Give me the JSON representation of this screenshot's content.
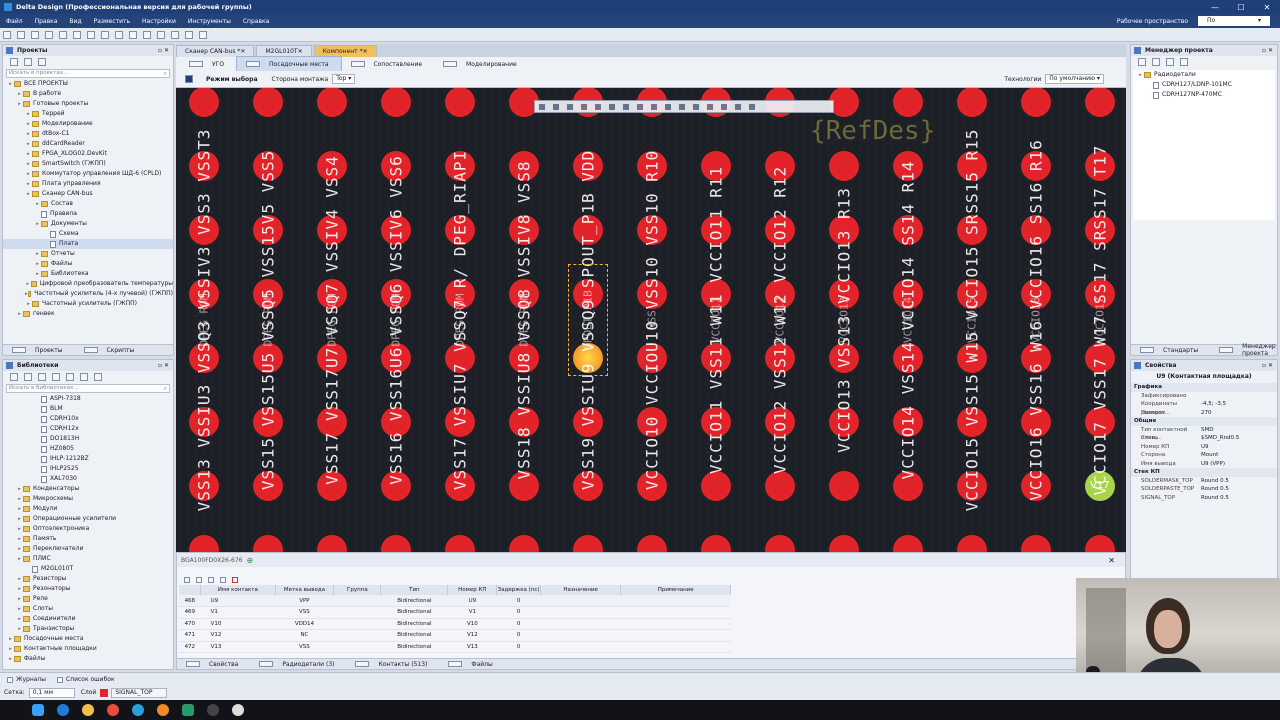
{
  "app": {
    "title": "Delta Design (Профессиональная версия для рабочей группы)",
    "window_min": "—",
    "window_max": "☐",
    "window_close": "✕"
  },
  "menu": {
    "items": [
      "Файл",
      "Правка",
      "Вид",
      "Разместить",
      "Настройки",
      "Инструменты",
      "Справка"
    ],
    "workspace_label": "Рабочее пространство",
    "workspace_value": "По умолчанию"
  },
  "projects_panel": {
    "title": "Проекты",
    "search_placeholder": "Искать в проектах...",
    "tree": [
      {
        "label": "ВСЕ ПРОЕКТЫ",
        "level": 0,
        "type": "folder"
      },
      {
        "label": "В работе",
        "level": 1,
        "type": "folder"
      },
      {
        "label": "Готовые проекты",
        "level": 1,
        "type": "folder"
      },
      {
        "label": "Террей",
        "level": 2,
        "type": "folder"
      },
      {
        "label": "Моделирование",
        "level": 2,
        "type": "folder"
      },
      {
        "label": "dtBox-C1",
        "level": 2,
        "type": "folder"
      },
      {
        "label": "ddCardReader",
        "level": 2,
        "type": "folder"
      },
      {
        "label": "FPGA_XLOG02.DevKit",
        "level": 2,
        "type": "folder"
      },
      {
        "label": "SmartSwitch (ГЖПП)",
        "level": 2,
        "type": "folder"
      },
      {
        "label": "Коммутатор управления ШД-6 (CPLD)",
        "level": 2,
        "type": "folder"
      },
      {
        "label": "Плата управления",
        "level": 2,
        "type": "folder"
      },
      {
        "label": "Сканер CAN-bus",
        "level": 2,
        "type": "folder"
      },
      {
        "label": "Состав",
        "level": 3,
        "type": "folder"
      },
      {
        "label": "Правила",
        "level": 3,
        "type": "doc"
      },
      {
        "label": "Документы",
        "level": 3,
        "type": "folder"
      },
      {
        "label": "Схема",
        "level": 4,
        "type": "doc"
      },
      {
        "label": "Плата",
        "level": 4,
        "type": "doc",
        "selected": true
      },
      {
        "label": "Отчеты",
        "level": 3,
        "type": "folder"
      },
      {
        "label": "Файлы",
        "level": 3,
        "type": "folder"
      },
      {
        "label": "Библиотека",
        "level": 3,
        "type": "folder"
      },
      {
        "label": "Цифровой преобразователь температуры",
        "level": 2,
        "type": "folder"
      },
      {
        "label": "Частотный усилитель (4-х лучевой) (ГЖПП)",
        "level": 2,
        "type": "folder"
      },
      {
        "label": "Частотный усилитель (ГЖПП)",
        "level": 2,
        "type": "folder"
      },
      {
        "label": "генвек",
        "level": 1,
        "type": "folder"
      }
    ],
    "tabs": [
      "Проекты",
      "Скрипты"
    ]
  },
  "libraries_panel": {
    "title": "Библиотеки",
    "search_placeholder": "Искать в библиотеках...",
    "tree": [
      {
        "label": "ASPI-7318",
        "level": 3,
        "type": "doc"
      },
      {
        "label": "BLM",
        "level": 3,
        "type": "doc"
      },
      {
        "label": "CDRH10x",
        "level": 3,
        "type": "doc"
      },
      {
        "label": "CDRH12x",
        "level": 3,
        "type": "doc"
      },
      {
        "label": "DO1813H",
        "level": 3,
        "type": "doc"
      },
      {
        "label": "HZ0805",
        "level": 3,
        "type": "doc"
      },
      {
        "label": "IHLP-1212BZ",
        "level": 3,
        "type": "doc"
      },
      {
        "label": "IHLP2525",
        "level": 3,
        "type": "doc"
      },
      {
        "label": "XAL7030",
        "level": 3,
        "type": "doc"
      },
      {
        "label": "Конденсаторы",
        "level": 1,
        "type": "folder"
      },
      {
        "label": "Микросхемы",
        "level": 1,
        "type": "folder"
      },
      {
        "label": "Модули",
        "level": 1,
        "type": "folder"
      },
      {
        "label": "Операционные усилители",
        "level": 1,
        "type": "folder"
      },
      {
        "label": "Оптоэлектроника",
        "level": 1,
        "type": "folder"
      },
      {
        "label": "Память",
        "level": 1,
        "type": "folder"
      },
      {
        "label": "Переключатели",
        "level": 1,
        "type": "folder"
      },
      {
        "label": "ПЛИС",
        "level": 1,
        "type": "folder"
      },
      {
        "label": "M2GL010T",
        "level": 2,
        "type": "doc"
      },
      {
        "label": "Резисторы",
        "level": 1,
        "type": "folder"
      },
      {
        "label": "Резонаторы",
        "level": 1,
        "type": "folder"
      },
      {
        "label": "Реле",
        "level": 1,
        "type": "folder"
      },
      {
        "label": "Слоты",
        "level": 1,
        "type": "folder"
      },
      {
        "label": "Соединители",
        "level": 1,
        "type": "folder"
      },
      {
        "label": "Транзисторы",
        "level": 1,
        "type": "folder"
      },
      {
        "label": "Посадочные места",
        "level": 0,
        "type": "folder"
      },
      {
        "label": "Контактные площадки",
        "level": 0,
        "type": "folder"
      },
      {
        "label": "Файлы",
        "level": 0,
        "type": "folder"
      }
    ]
  },
  "doc_tabs": [
    {
      "label": "Сканер CAN-bus *",
      "active": false
    },
    {
      "label": "M2GL010T",
      "active": false
    },
    {
      "label": "Компонент *",
      "active": true
    }
  ],
  "sub_tabs": [
    {
      "label": "УГО",
      "active": false
    },
    {
      "label": "Посадочные места",
      "active": true
    },
    {
      "label": "Сопоставление",
      "active": false
    },
    {
      "label": "Моделирование",
      "active": false
    }
  ],
  "mode_bar": {
    "mode_label": "Режим выбора",
    "side_label": "Сторона монтажа",
    "side_value": "Top",
    "tech_label": "Технологии",
    "tech_value": "По умолчанию"
  },
  "canvas": {
    "refdes": "{RefDes}",
    "columns": [
      {
        "text": "VSS13 VSSIU3 VSSQ3 VSSIV3 VSS3 VSST3",
        "ghost": "DPEG ROM"
      },
      {
        "text": "VSS15 VSS15U5 VSSQ5 VSS15V5 VSS5",
        "ghost": "DPEG ROM"
      },
      {
        "text": "VSS17 VSS17U7 VSSQ7 VSSIV4 VSS4",
        "ghost": "DPEG ROM"
      },
      {
        "text": "VSS16 VSS16U6 VSSQ6 VSSIV6 VSS6",
        "ghost": "DPEG ROM"
      },
      {
        "text": "VSS17 VSSIU7 VSSQ7 R/ DPEG_RIAPI",
        "ghost": "DPEG ROM"
      },
      {
        "text": "VSS18 VSSIU8 VSSQ8 VSSIV8 VSS8",
        "ghost": "DPEG ROM"
      },
      {
        "text": "VSS19 VSSIU9 VSSQ9 SPOUT_P1B VDD",
        "ghost": "SPOUT_P1B"
      },
      {
        "text": "VCCIO10 VCCIOU10 VSS10 VSS10 R10",
        "ghost": "NSS"
      },
      {
        "text": "VCCIO11 VSS11 W11 VCCIO11 R11",
        "ghost": "VCCIO11"
      },
      {
        "text": "VCCIO12 VSS12 W12 VCCIO12 R12",
        "ghost": "VCCIO12"
      },
      {
        "text": "VCCIO13 VSS13 VCCIO13 R13",
        "ghost": "VCCIO13"
      },
      {
        "text": "VCCIO14 VSS14 VCCIO14 SS14 R14",
        "ghost": "VCCIO14"
      },
      {
        "text": "VCCIO15 VSS15 W15 VCCIO15 SRSS15 R15",
        "ghost": "VCCIO15"
      },
      {
        "text": "VCCIO16 VSS16 W16 VCCIO16 SS16 R16",
        "ghost": "VCCIO16"
      },
      {
        "text": "VCCIO17 VSS17 W17 SS17 SRSS17 T17",
        "ghost": "VCCIO17"
      }
    ],
    "green_pad_label": "V17"
  },
  "bottom_pane": {
    "tab_label": "BGA100FD0X26-676",
    "columns": [
      "Имя контакта",
      "Метка вывода",
      "Группа",
      "Тип",
      "Номер КП",
      "Задержка (пс)",
      "Назначение",
      "Примечание"
    ],
    "rows": [
      {
        "n": "468",
        "name": "U9",
        "label": "VPP",
        "group": "",
        "type": "Bidirectional",
        "pad": "U9",
        "delay": "0"
      },
      {
        "n": "469",
        "name": "V1",
        "label": "VSS",
        "group": "",
        "type": "Bidirectional",
        "pad": "V1",
        "delay": "0"
      },
      {
        "n": "470",
        "name": "V10",
        "label": "VDD14",
        "group": "",
        "type": "Bidirectional",
        "pad": "V10",
        "delay": "0"
      },
      {
        "n": "471",
        "name": "V12",
        "label": "NC",
        "group": "",
        "type": "Bidirectional",
        "pad": "V12",
        "delay": "0"
      },
      {
        "n": "472",
        "name": "V13",
        "label": "VSS",
        "group": "",
        "type": "Bidirectional",
        "pad": "V13",
        "delay": "0"
      }
    ],
    "tabs": [
      "Свойства",
      "Радиодетали (3)",
      "Контакты (513)",
      "Файлы"
    ]
  },
  "project_manager": {
    "title": "Менеджер проекта",
    "tree": [
      {
        "label": "Радиодетали",
        "level": 0
      },
      {
        "label": "CDRH127/LDNP-101MC",
        "level": 1
      },
      {
        "label": "CDRH127NP-470MC",
        "level": 1
      }
    ],
    "tabs": [
      "Стандарты",
      "Менеджер проекта"
    ]
  },
  "properties": {
    "title": "Свойства",
    "object": "U9 (Контактная площадка)",
    "rows": [
      {
        "section": "Графика"
      },
      {
        "k": "Зафиксировано",
        "v": ""
      },
      {
        "k": "Координаты располо...",
        "v": "-4,5; -3,5"
      },
      {
        "k": "Поворот",
        "v": "270"
      },
      {
        "section": "Общие"
      },
      {
        "k": "Тип контактной площ...",
        "v": "SMD"
      },
      {
        "k": "Стиль",
        "v": "$SMD_Rnd0.5"
      },
      {
        "k": "Номер КП",
        "v": "U9"
      },
      {
        "k": "Сторона",
        "v": "Mount"
      },
      {
        "k": "Имя вывода",
        "v": "U9 (VPP)"
      },
      {
        "section": "Стек КП"
      },
      {
        "k": "SOLDERMASK_TOP",
        "v": "Round 0.5"
      },
      {
        "k": "SOLDERPASTE_TOP",
        "v": "Round 0.5"
      },
      {
        "k": "SIGNAL_TOP",
        "v": "Round 0.5"
      }
    ]
  },
  "status": {
    "tabs": [
      "Журналы",
      "Список ошибок"
    ],
    "grid_label": "Сетка:",
    "grid_value": "0,1 мм",
    "layer_label": "Слой",
    "layer_value": "SIGNAL_TOP",
    "layer_color": "#e2232a"
  },
  "taskbar": {
    "icons": [
      "windows-icon",
      "edge-icon",
      "explorer-icon",
      "chrome-icon",
      "telegram-icon",
      "firefox-icon",
      "delta-design-icon",
      "obs-icon",
      "media-icon"
    ]
  },
  "colors": {
    "accent": "#1f3f78",
    "pad": "#e2232a",
    "active_tab": "#f2c05a",
    "canvas_bg": "#1d2026"
  }
}
